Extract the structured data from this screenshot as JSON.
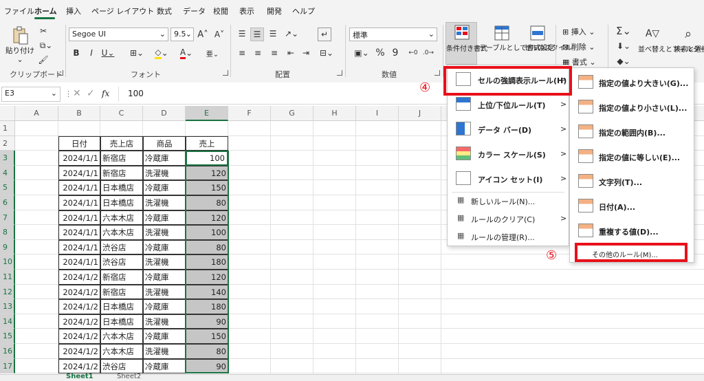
{
  "tabs": [
    "ファイル",
    "ホーム",
    "挿入",
    "ページ レイアウト",
    "数式",
    "データ",
    "校閲",
    "表示",
    "開発",
    "ヘルプ"
  ],
  "clipboard": {
    "paste": "貼り付け",
    "group": "クリップボード"
  },
  "font": {
    "name": "Segoe UI",
    "size": "9.5",
    "group": "フォント",
    "bold": "B",
    "italic": "I",
    "underline": "U"
  },
  "alignment": {
    "group": "配置"
  },
  "number": {
    "format": "標準",
    "group": "数値",
    "percent": "%",
    "comma": "9"
  },
  "styles": {
    "cond_format": "条件付き書式",
    "table_format": "テーブルとして書式設定",
    "cell_style": "セルのスタイル"
  },
  "cells": {
    "insert": "挿入",
    "delete": "削除",
    "format": "書式"
  },
  "editing": {
    "sort": "並べ替えとフィルター",
    "find": "検索と選択"
  },
  "formula_bar": {
    "name_box": "E3",
    "fx": "fx",
    "value": "100"
  },
  "columns": [
    "A",
    "B",
    "C",
    "D",
    "E",
    "F",
    "G",
    "H",
    "I",
    "J"
  ],
  "rows": [
    "1",
    "2",
    "3",
    "4",
    "5",
    "6",
    "7",
    "8",
    "9",
    "10",
    "11",
    "12",
    "13",
    "14",
    "15",
    "16",
    "17"
  ],
  "table": {
    "headers": [
      "日付",
      "売上店",
      "商品",
      "売上"
    ],
    "data": [
      [
        "2024/1/1",
        "新宿店",
        "冷蔵庫",
        "100"
      ],
      [
        "2024/1/1",
        "新宿店",
        "洗濯機",
        "120"
      ],
      [
        "2024/1/1",
        "日本橋店",
        "冷蔵庫",
        "150"
      ],
      [
        "2024/1/1",
        "日本橋店",
        "洗濯機",
        "80"
      ],
      [
        "2024/1/1",
        "六本木店",
        "冷蔵庫",
        "120"
      ],
      [
        "2024/1/1",
        "六本木店",
        "洗濯機",
        "100"
      ],
      [
        "2024/1/1",
        "渋谷店",
        "冷蔵庫",
        "80"
      ],
      [
        "2024/1/1",
        "渋谷店",
        "洗濯機",
        "180"
      ],
      [
        "2024/1/2",
        "新宿店",
        "冷蔵庫",
        "120"
      ],
      [
        "2024/1/2",
        "新宿店",
        "洗濯機",
        "140"
      ],
      [
        "2024/1/2",
        "日本橋店",
        "冷蔵庫",
        "180"
      ],
      [
        "2024/1/2",
        "日本橋店",
        "洗濯機",
        "90"
      ],
      [
        "2024/1/2",
        "六本木店",
        "冷蔵庫",
        "150"
      ],
      [
        "2024/1/2",
        "六本木店",
        "洗濯機",
        "80"
      ],
      [
        "2024/1/2",
        "渋谷店",
        "冷蔵庫",
        "90"
      ]
    ]
  },
  "menu1": [
    {
      "label": "セルの強調表示ルール(H)",
      "arrow": ">"
    },
    {
      "label": "上位/下位ルール(T)",
      "arrow": ">"
    },
    {
      "label": "データ バー(D)",
      "arrow": ">"
    },
    {
      "label": "カラー スケール(S)",
      "arrow": ">"
    },
    {
      "label": "アイコン セット(I)",
      "arrow": ">"
    },
    {
      "label": "新しいルール(N)..."
    },
    {
      "label": "ルールのクリア(C)",
      "arrow": ">"
    },
    {
      "label": "ルールの管理(R)..."
    }
  ],
  "menu2": [
    "指定の値より大きい(G)...",
    "指定の値より小さい(L)...",
    "指定の範囲内(B)...",
    "指定の値に等しい(E)...",
    "文字列(T)...",
    "日付(A)...",
    "重複する値(D)...",
    "その他のルール(M)..."
  ],
  "callouts": {
    "step4": "④",
    "step5": "⑤"
  },
  "sheets": [
    "Sheet1",
    "Sheet2"
  ],
  "colors": {
    "accent": "#1a7343",
    "highlight": "#e8101a",
    "selected_fill": "#c6c6c6"
  }
}
